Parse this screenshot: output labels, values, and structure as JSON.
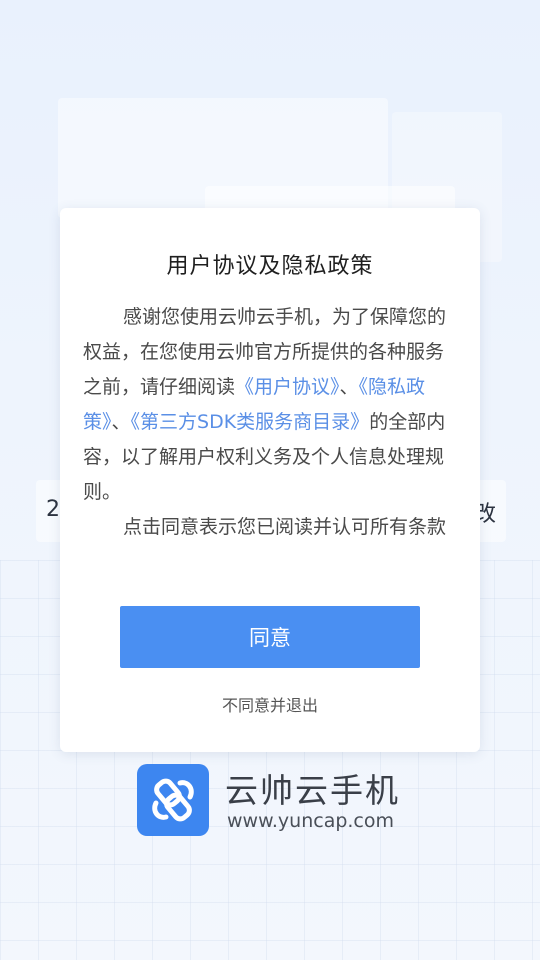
{
  "dialog": {
    "title": "用户协议及隐私政策",
    "para1_before": "感谢您使用云帅云手机，为了保障您的权益，在您使用云帅官方所提供的各种服务之前，请仔细阅读",
    "link_user_agreement": "《用户协议》",
    "sep1": "、",
    "link_privacy": "《隐私政策》",
    "sep2": "、",
    "link_sdk": "《第三方SDK类服务商目录》",
    "para1_after": "的全部内容，以了解用户权利义务及个人信息处理规则。",
    "para2": "点击同意表示您已阅读并认可所有条款",
    "agree_label": "同意",
    "reject_label": "不同意并退出"
  },
  "brand": {
    "name": "云帅云手机",
    "url": "www.yuncap.com",
    "logo_icon": "phone-link-icon",
    "color": "#3d86f0"
  },
  "background": {
    "peek_left": "2",
    "peek_right": "改"
  },
  "colors": {
    "accent": "#4a8ff2",
    "link": "#5a8fe6"
  }
}
